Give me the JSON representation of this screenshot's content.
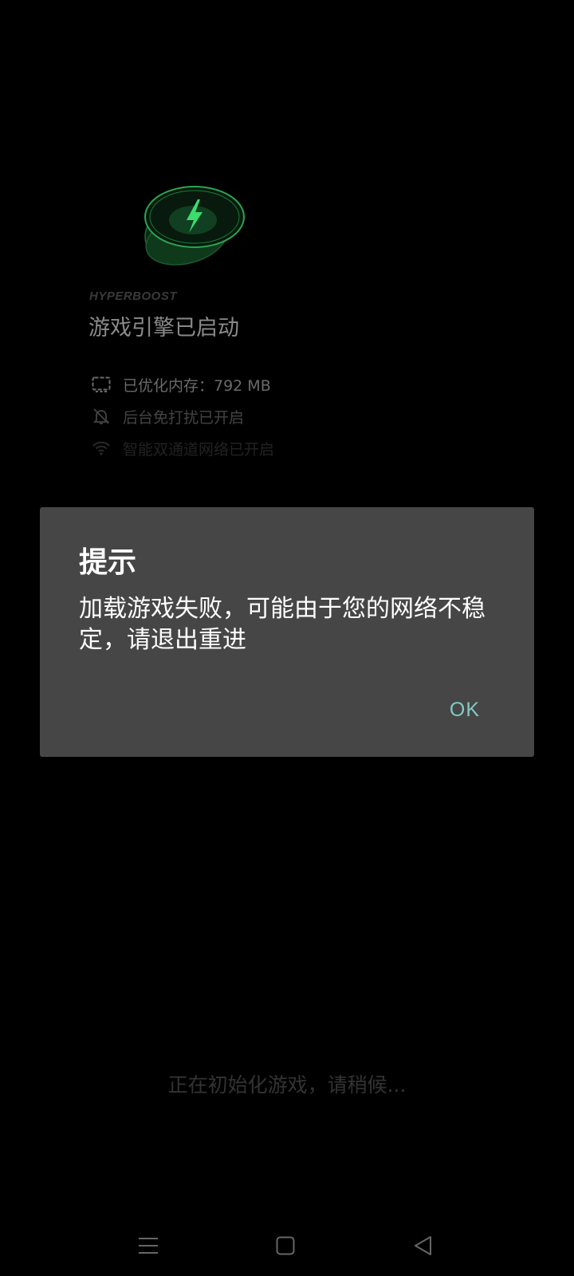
{
  "engine": {
    "brand": "HYPERBOOST",
    "title": "游戏引擎已启动",
    "status": [
      {
        "icon": "memory-icon",
        "text": "已优化内存：792 MB"
      },
      {
        "icon": "bell-off-icon",
        "text": "后台免打扰已开启"
      },
      {
        "icon": "wifi-icon",
        "text": "智能双通道网络已开启"
      }
    ]
  },
  "dialog": {
    "title": "提示",
    "message": "加载游戏失败，可能由于您的网络不稳定，请退出重进",
    "ok_label": "OK"
  },
  "loading_text": "正在初始化游戏，请稍候...",
  "colors": {
    "accent": "#80cbc4",
    "dialog_bg": "#464646",
    "logo_green": "#3ddc6e"
  },
  "navbar": {
    "icons": [
      "menu-icon",
      "home-icon",
      "back-icon"
    ]
  }
}
